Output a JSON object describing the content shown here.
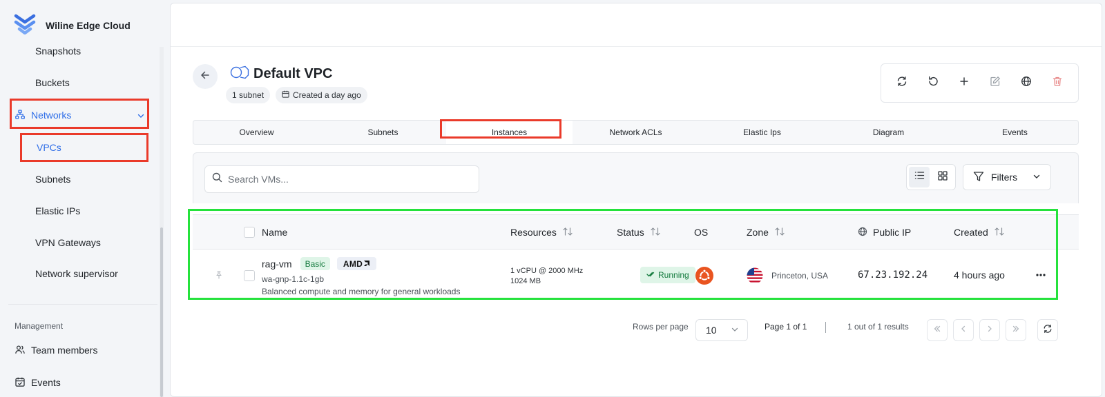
{
  "brand": {
    "name": "Wiline Edge Cloud",
    "logo_icon": "wiline-logo-icon"
  },
  "sidebar": {
    "items": [
      {
        "label": "Snapshots"
      },
      {
        "label": "Buckets"
      },
      {
        "label": "Networks",
        "icon": "network-icon"
      },
      {
        "label": "VPCs"
      },
      {
        "label": "Subnets"
      },
      {
        "label": "Elastic IPs"
      },
      {
        "label": "VPN Gateways"
      },
      {
        "label": "Network supervisor"
      }
    ],
    "section_management": "Management",
    "management_items": [
      {
        "label": "Team members",
        "icon": "users-icon"
      },
      {
        "label": "Events",
        "icon": "calendar-icon"
      }
    ]
  },
  "vpc": {
    "title": "Default VPC",
    "subnet_chip": "1 subnet",
    "created_chip": "Created a day ago"
  },
  "tabs": [
    "Overview",
    "Subnets",
    "Instances",
    "Network ACLs",
    "Elastic Ips",
    "Diagram",
    "Events"
  ],
  "active_tab": "Instances",
  "search": {
    "placeholder": "Search VMs..."
  },
  "filters_label": "Filters",
  "table": {
    "headers": {
      "name": "Name",
      "resources": "Resources",
      "status": "Status",
      "os": "OS",
      "zone": "Zone",
      "public_ip": "Public IP",
      "created": "Created"
    },
    "rows": [
      {
        "name": "rag-vm",
        "tier_badge": "Basic",
        "cpu_brand": "AMD",
        "plan": "wa-gnp-1.1c-1gb",
        "description": "Balanced compute and memory for general workloads",
        "resources_cpu": "1 vCPU @ 2000 MHz",
        "resources_mem": "1024 MB",
        "status": "Running",
        "os_icon": "ubuntu-icon",
        "zone_flag": "us-flag-icon",
        "zone": "Princeton, USA",
        "public_ip": "67.23.192.24",
        "created": "4 hours ago"
      }
    ]
  },
  "pagination": {
    "rows_per_page_label": "Rows per page",
    "rows_per_page": "10",
    "page_label": "Page 1 of 1",
    "results_label": "1 out of 1 results"
  },
  "colors": {
    "accent": "#2f6ee8",
    "highlight_red": "#ea3a2a",
    "highlight_green": "#25e23c",
    "status_running_bg": "#dff5e8",
    "ubuntu_orange": "#e95420",
    "delete_red": "#e25b5b"
  }
}
